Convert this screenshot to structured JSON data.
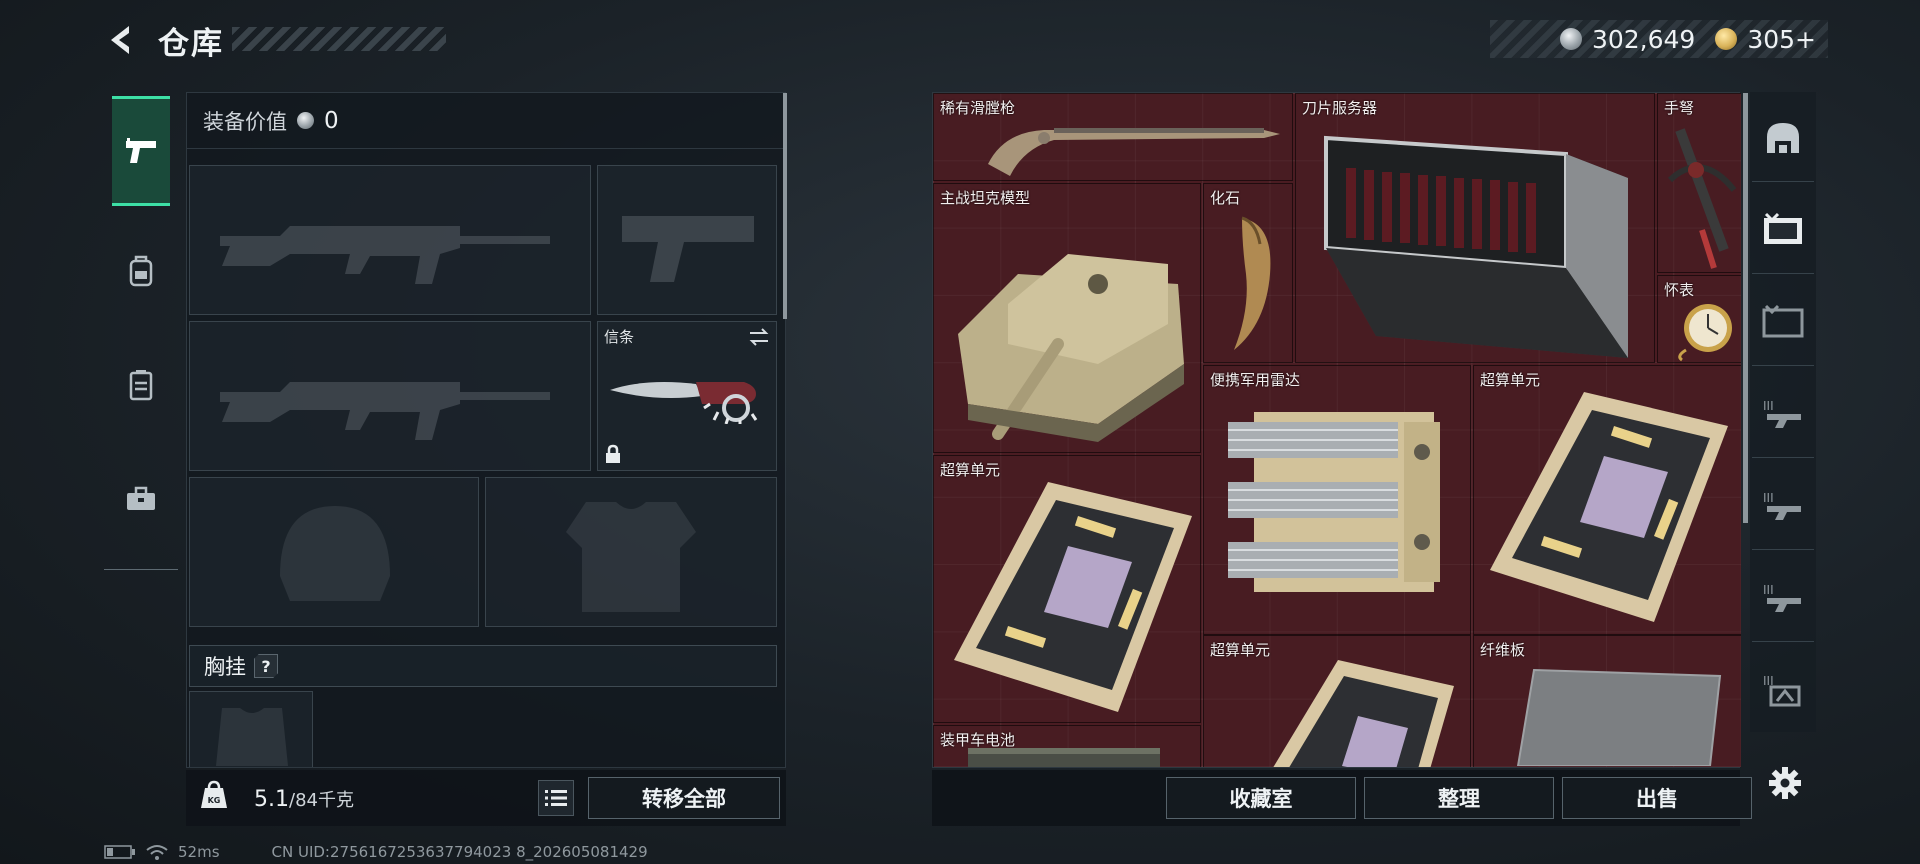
{
  "header": {
    "title": "仓库",
    "currencies": [
      {
        "icon": "silver-coin-icon",
        "value": "302,649",
        "color": "#b9c0c6"
      },
      {
        "icon": "gold-triangle-coin-icon",
        "value": "305+",
        "color": "#d9b35a"
      }
    ]
  },
  "left_rail": {
    "items": [
      {
        "icon": "pistol-icon",
        "active": true
      },
      {
        "icon": "backpack-icon",
        "active": false
      },
      {
        "icon": "locker-icon",
        "active": false
      },
      {
        "icon": "toolbox-icon",
        "active": false
      }
    ]
  },
  "loadout": {
    "value_label": "装备价值",
    "value": "0",
    "melee_slot_label": "信条",
    "chest_rig_label": "胸挂",
    "chest_rig_help": "?",
    "weight_current": "5.1",
    "weight_capacity": "/84千克",
    "transfer_all_label": "转移全部"
  },
  "stash": {
    "items": [
      {
        "name": "稀有滑膛枪",
        "icon": "musket-icon"
      },
      {
        "name": "刀片服务器",
        "icon": "blade-server-icon"
      },
      {
        "name": "手弩",
        "icon": "hand-crossbow-icon"
      },
      {
        "name": "主战坦克模型",
        "icon": "tank-model-icon"
      },
      {
        "name": "化石",
        "icon": "fossil-claw-icon"
      },
      {
        "name": "怀表",
        "icon": "pocket-watch-icon"
      },
      {
        "name": "便携军用雷达",
        "icon": "portable-radar-icon"
      },
      {
        "name": "超算单元",
        "icon": "supercomputer-unit-icon"
      },
      {
        "name": "超算单元",
        "icon": "supercomputer-unit-icon"
      },
      {
        "name": "超算单元",
        "icon": "supercomputer-unit-icon"
      },
      {
        "name": "纤维板",
        "icon": "fiberboard-icon"
      },
      {
        "name": "装甲车电池",
        "icon": "armored-vehicle-battery-icon"
      }
    ],
    "actions": {
      "collection_label": "收藏室",
      "sort_label": "整理",
      "sell_label": "出售"
    }
  },
  "right_rail": {
    "filters": [
      "helmet-icon",
      "voucher-icon",
      "voucher-outline-icon",
      "tier3-weapon-icon",
      "tier3-gun-icon",
      "tier3-rifle-icon",
      "tier3-armor-icon"
    ]
  },
  "status": {
    "ping": "52ms",
    "uid": "CN UID:2756167253637794023 8_202605081429"
  },
  "colors": {
    "accent": "#3de0a6",
    "stash_bg": "#4a1c22"
  }
}
